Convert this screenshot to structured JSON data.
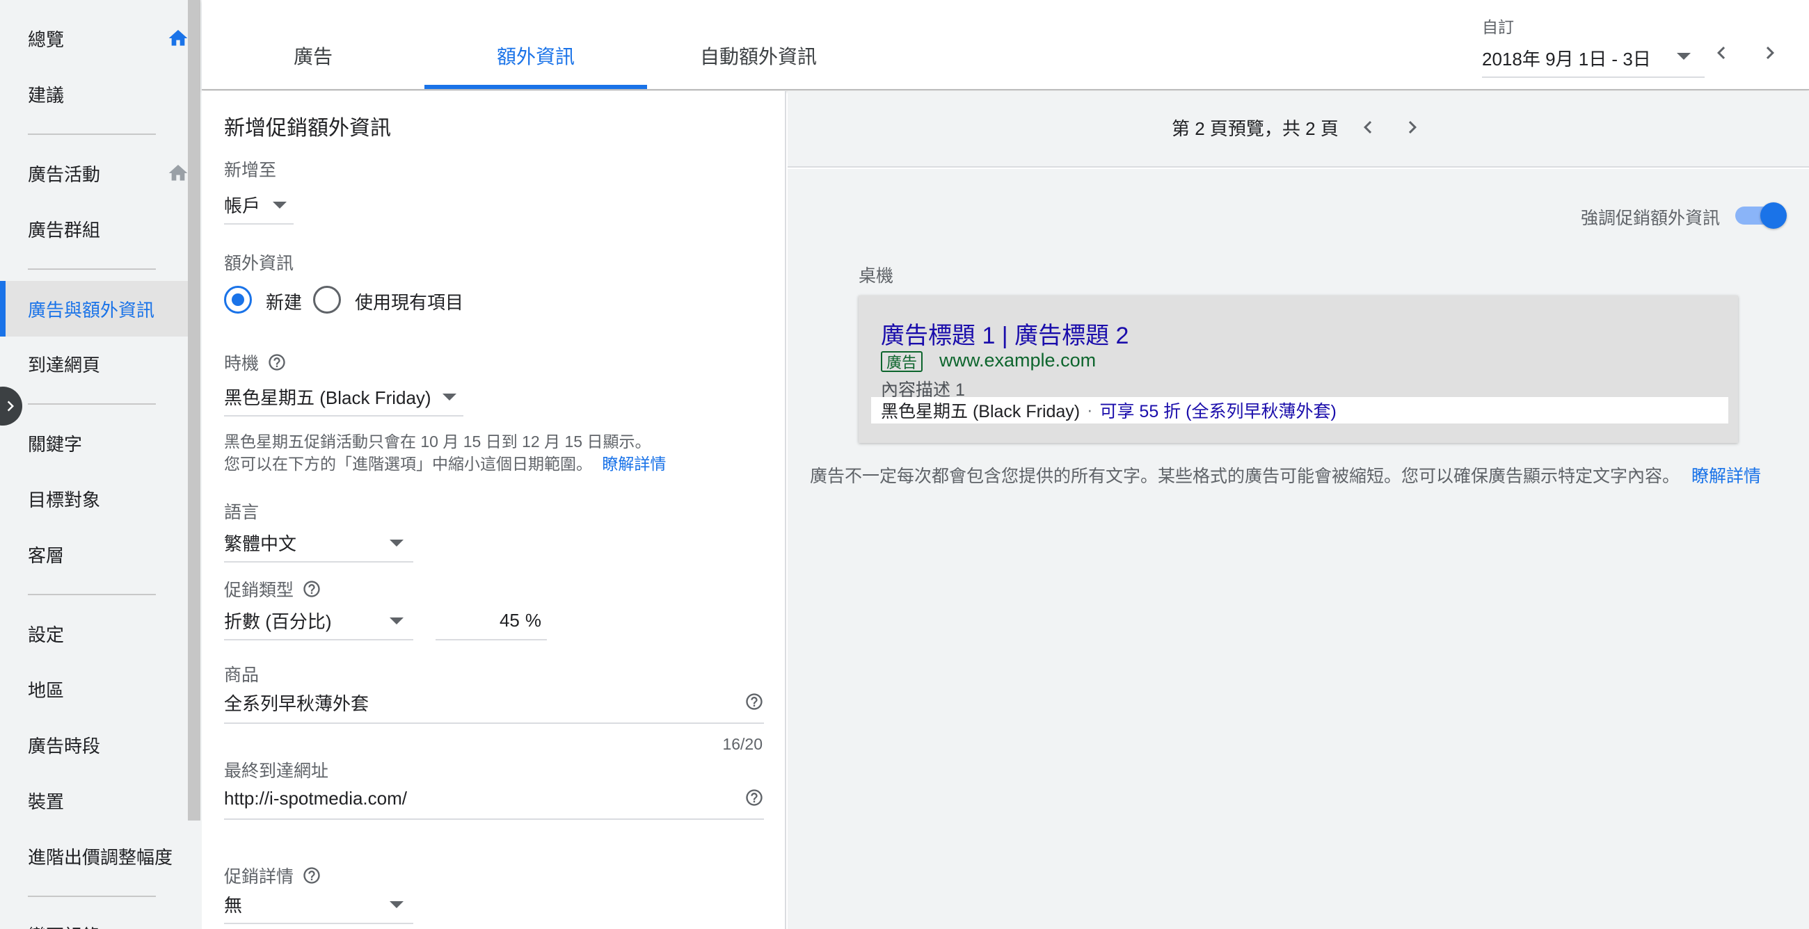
{
  "sidebar": {
    "items": [
      {
        "label": "總覽",
        "home": true
      },
      {
        "label": "建議"
      },
      {
        "label": "廣告活動",
        "home": true
      },
      {
        "label": "廣告群組"
      },
      {
        "label": "廣告與額外資訊",
        "active": true
      },
      {
        "label": "到達網頁"
      },
      {
        "label": "關鍵字"
      },
      {
        "label": "目標對象"
      },
      {
        "label": "客層"
      },
      {
        "label": "設定"
      },
      {
        "label": "地區"
      },
      {
        "label": "廣告時段"
      },
      {
        "label": "裝置"
      },
      {
        "label": "進階出價調整幅度"
      },
      {
        "label": "變更記錄"
      }
    ]
  },
  "tabs": [
    {
      "label": "廣告"
    },
    {
      "label": "額外資訊",
      "active": true
    },
    {
      "label": "自動額外資訊"
    }
  ],
  "date_range": {
    "caption": "自訂",
    "value": "2018年 9月 1日 - 3日"
  },
  "form": {
    "title": "新增促銷額外資訊",
    "add_to": {
      "label": "新增至",
      "value": "帳戶"
    },
    "extension": {
      "label": "額外資訊",
      "option_new": "新建",
      "option_existing": "使用現有項目",
      "selected": "新建"
    },
    "occasion": {
      "label": "時機",
      "value": "黑色星期五 (Black Friday)",
      "hint_line1": "黑色星期五促銷活動只會在 10 月 15 日到 12 月 15 日顯示。",
      "hint_line2": "您可以在下方的「進階選項」中縮小這個日期範圍。",
      "hint_link": "瞭解詳情"
    },
    "language": {
      "label": "語言",
      "value": "繁體中文"
    },
    "promotion_type": {
      "label": "促銷類型",
      "value": "折數 (百分比)",
      "percent_value": "45",
      "percent_unit": "%"
    },
    "item": {
      "label": "商品",
      "value": "全系列早秋薄外套",
      "counter": "16/20"
    },
    "final_url": {
      "label": "最終到達網址",
      "value": "http://i-spotmedia.com/"
    },
    "promotion_details": {
      "label": "促銷詳情",
      "value": "無"
    }
  },
  "preview": {
    "page_text": "第 2 頁預覽，共 2 頁",
    "highlight_label": "強調促銷額外資訊",
    "highlight_on": true,
    "device_label": "桌機",
    "ad": {
      "headline": "廣告標題 1 | 廣告標題 2",
      "badge": "廣告",
      "display_url": "www.example.com",
      "description": "內容描述 1",
      "promo_occasion": "黑色星期五 (Black Friday)",
      "promo_separator": "·",
      "promo_offer": "可享 55 折 (全系列早秋薄外套)"
    },
    "disclaimer_text": "廣告不一定每次都會包含您提供的所有文字。某些格式的廣告可能會被縮短。您可以確保廣告顯示特定文字內容。",
    "disclaimer_link": "瞭解詳情"
  },
  "colors": {
    "accent": "#1a73e8",
    "ad_headline": "#1a0dab",
    "ad_url": "#0d652d",
    "panel_bg": "#f1f3f4"
  },
  "icons": [
    "home-icon",
    "chevron-right-icon",
    "chevron-left-icon",
    "caret-down-icon",
    "help-icon"
  ]
}
